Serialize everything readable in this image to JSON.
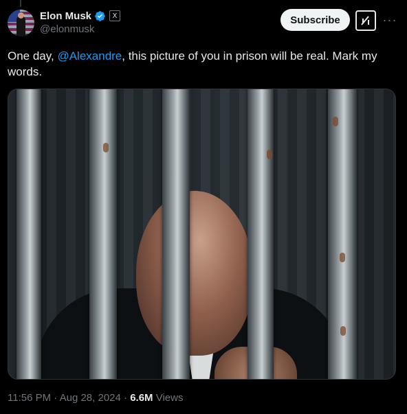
{
  "author": {
    "name": "Elon Musk",
    "handle": "@elonmusk",
    "verified_badge_color": "#1d9bf0",
    "affiliate_badge": "X"
  },
  "actions": {
    "subscribe_label": "Subscribe",
    "grok_icon": "grok-icon",
    "more_icon": "more-icon"
  },
  "tweet": {
    "text_before": "One day, ",
    "mention": "@Alexandre",
    "text_after": ", this picture of you in prison will be real. Mark my words."
  },
  "media": {
    "icon": "image-of-man-behind-prison-bars"
  },
  "meta": {
    "time": "11:56 PM",
    "sep1": " · ",
    "date": "Aug 28, 2024",
    "sep2": " · ",
    "views_count": "6.6M",
    "views_label": " Views"
  },
  "colors": {
    "background": "#000000",
    "text": "#e7e9ea",
    "secondary": "#71767b",
    "link": "#1d9bf0"
  }
}
